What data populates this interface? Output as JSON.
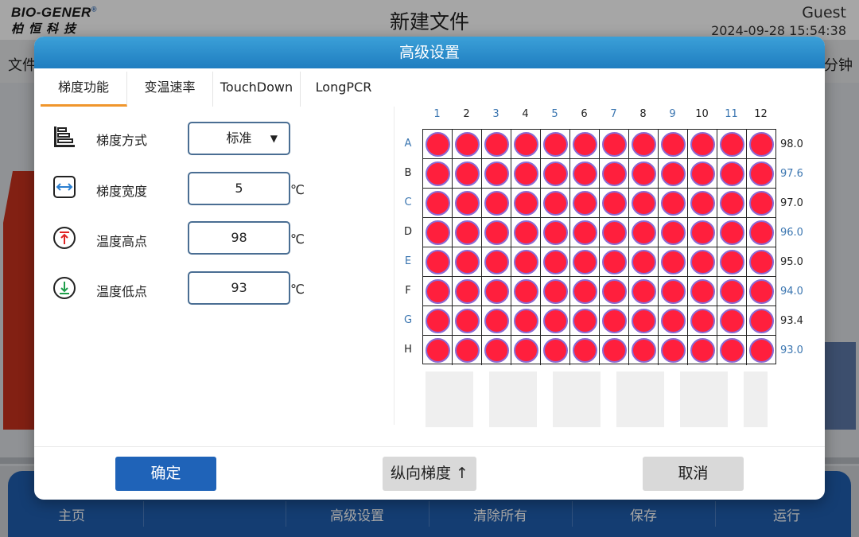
{
  "app": {
    "logo_top": "BIO-GENER",
    "logo_reg": "®",
    "logo_bottom": "柏恒科技",
    "title": "新建文件",
    "user": "Guest",
    "datetime": "2024-09-28 15:54:38",
    "menu_file": "文件",
    "menu_minutes": "分钟"
  },
  "bottom_nav": {
    "items": [
      "主页",
      "",
      "高级设置",
      "清除所有",
      "保存",
      "运行"
    ]
  },
  "dialog": {
    "title": "高级设置",
    "tabs": [
      "梯度功能",
      "变温速率",
      "TouchDown",
      "LongPCR"
    ],
    "active_tab": "梯度功能",
    "rows": [
      {
        "label": "梯度方式",
        "value": "标准",
        "type": "dropdown",
        "icon": "gradient-steps-icon"
      },
      {
        "label": "梯度宽度",
        "value": "5",
        "unit": "℃",
        "icon": "width-arrows-icon"
      },
      {
        "label": "温度高点",
        "value": "98",
        "unit": "℃",
        "icon": "high-temp-icon"
      },
      {
        "label": "温度低点",
        "value": "93",
        "unit": "℃",
        "icon": "low-temp-icon"
      }
    ],
    "plate": {
      "columns": [
        "1",
        "2",
        "3",
        "4",
        "5",
        "6",
        "7",
        "8",
        "9",
        "10",
        "11",
        "12"
      ],
      "rows": [
        "A",
        "B",
        "C",
        "D",
        "E",
        "F",
        "G",
        "H"
      ],
      "row_temps": [
        "98.0",
        "97.6",
        "97.0",
        "96.0",
        "95.0",
        "94.0",
        "93.4",
        "93.0"
      ],
      "well_color": "#ff1f3d",
      "well_border": "#8b6ad4"
    },
    "buttons": {
      "ok": "确定",
      "gradient": "纵向梯度 ↑",
      "cancel": "取消"
    }
  },
  "colors": {
    "header_blue": "#1f7dc0",
    "primary_button": "#1f63b8",
    "tab_underline": "#f0962c",
    "label_blue": "#3a75b0"
  }
}
